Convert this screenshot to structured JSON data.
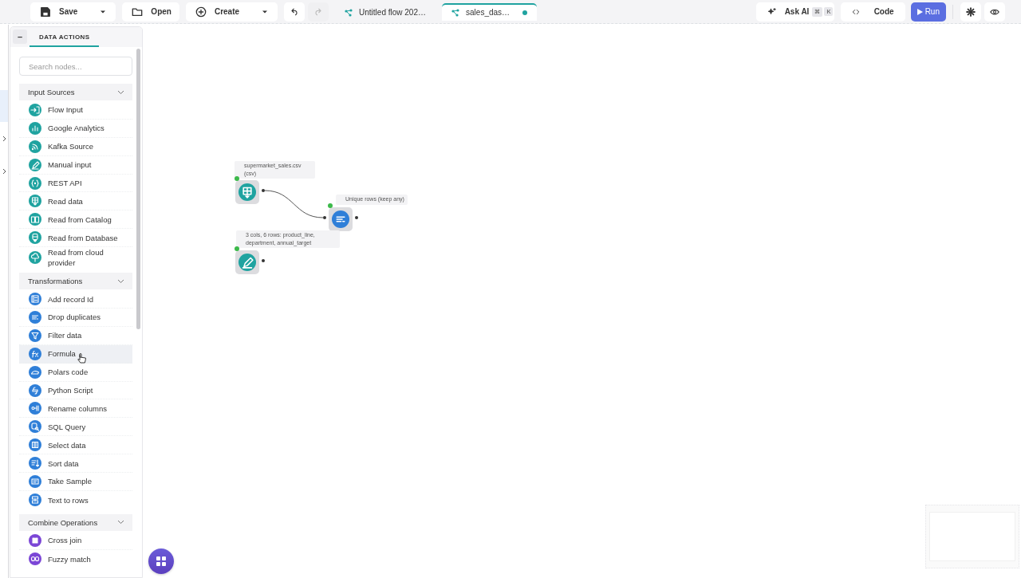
{
  "toolbar": {
    "save": {
      "label": "Save"
    },
    "open": {
      "label": "Open"
    },
    "create": {
      "label": "Create"
    },
    "tabs": [
      {
        "label": "Untitled flow 202…",
        "selected": false,
        "modified": false
      },
      {
        "label": "sales_das…",
        "selected": true,
        "modified": true
      }
    ],
    "ask_ai": {
      "label": "Ask AI",
      "keys": [
        "⌘",
        "K"
      ]
    },
    "code": {
      "label": "Code"
    },
    "run": {
      "label": "Run"
    }
  },
  "panel": {
    "collapse": "–",
    "tab": "DATA ACTIONS",
    "search": {
      "placeholder": "Search nodes..."
    },
    "groups": [
      {
        "title": "Input Sources",
        "expanded": true,
        "color": "#1fa3a0",
        "items": [
          {
            "label": "Flow Input",
            "kind": "enter",
            "hovered": false
          },
          {
            "label": "Google Analytics",
            "kind": "bars",
            "hovered": false
          },
          {
            "label": "Kafka Source",
            "kind": "rss",
            "hovered": false
          },
          {
            "label": "Manual input",
            "kind": "pen",
            "hovered": false
          },
          {
            "label": "REST API",
            "kind": "braces",
            "hovered": false
          },
          {
            "label": "Read data",
            "kind": "table",
            "hovered": false
          },
          {
            "label": "Read from Catalog",
            "kind": "book",
            "hovered": false
          },
          {
            "label": "Read from Database",
            "kind": "database",
            "hovered": false
          },
          {
            "label": "Read from cloud provider",
            "kind": "cloud",
            "hovered": false
          }
        ]
      },
      {
        "title": "Transformations",
        "expanded": true,
        "color": "#2f7fd8",
        "items": [
          {
            "label": "Add record Id",
            "kind": "list",
            "hovered": false
          },
          {
            "label": "Drop duplicates",
            "kind": "lines",
            "hovered": false
          },
          {
            "label": "Filter data",
            "kind": "funnel",
            "hovered": false
          },
          {
            "label": "Formula",
            "kind": "fx",
            "hovered": true
          },
          {
            "label": "Polars code",
            "kind": "bear",
            "hovered": false
          },
          {
            "label": "Python Script",
            "kind": "python",
            "hovered": false
          },
          {
            "label": "Rename columns",
            "kind": "rename",
            "hovered": false
          },
          {
            "label": "SQL Query",
            "kind": "search",
            "hovered": false
          },
          {
            "label": "Select data",
            "kind": "columns",
            "hovered": false
          },
          {
            "label": "Sort data",
            "kind": "sort",
            "hovered": false
          },
          {
            "label": "Take Sample",
            "kind": "sample",
            "hovered": false
          },
          {
            "label": "Text to rows",
            "kind": "rows",
            "hovered": false
          }
        ]
      },
      {
        "title": "Combine Operations",
        "expanded": true,
        "color": "#7b46d6",
        "items": [
          {
            "label": "Cross join",
            "kind": "grid",
            "hovered": false
          },
          {
            "label": "Fuzzy match",
            "kind": "link",
            "hovered": false
          }
        ]
      }
    ]
  },
  "canvas": {
    "nodes": [
      {
        "label": "supermarket_sales.csv (csv)",
        "kind": "table",
        "color": "#1fa3a0"
      },
      {
        "label": "Unique rows (keep any)",
        "kind": "lines",
        "color": "#2f7fd8"
      },
      {
        "label": "3 cols, 6 rows: product_line, department, annual_target",
        "kind": "pen",
        "color": "#1fa3a0"
      }
    ],
    "edge": true
  }
}
